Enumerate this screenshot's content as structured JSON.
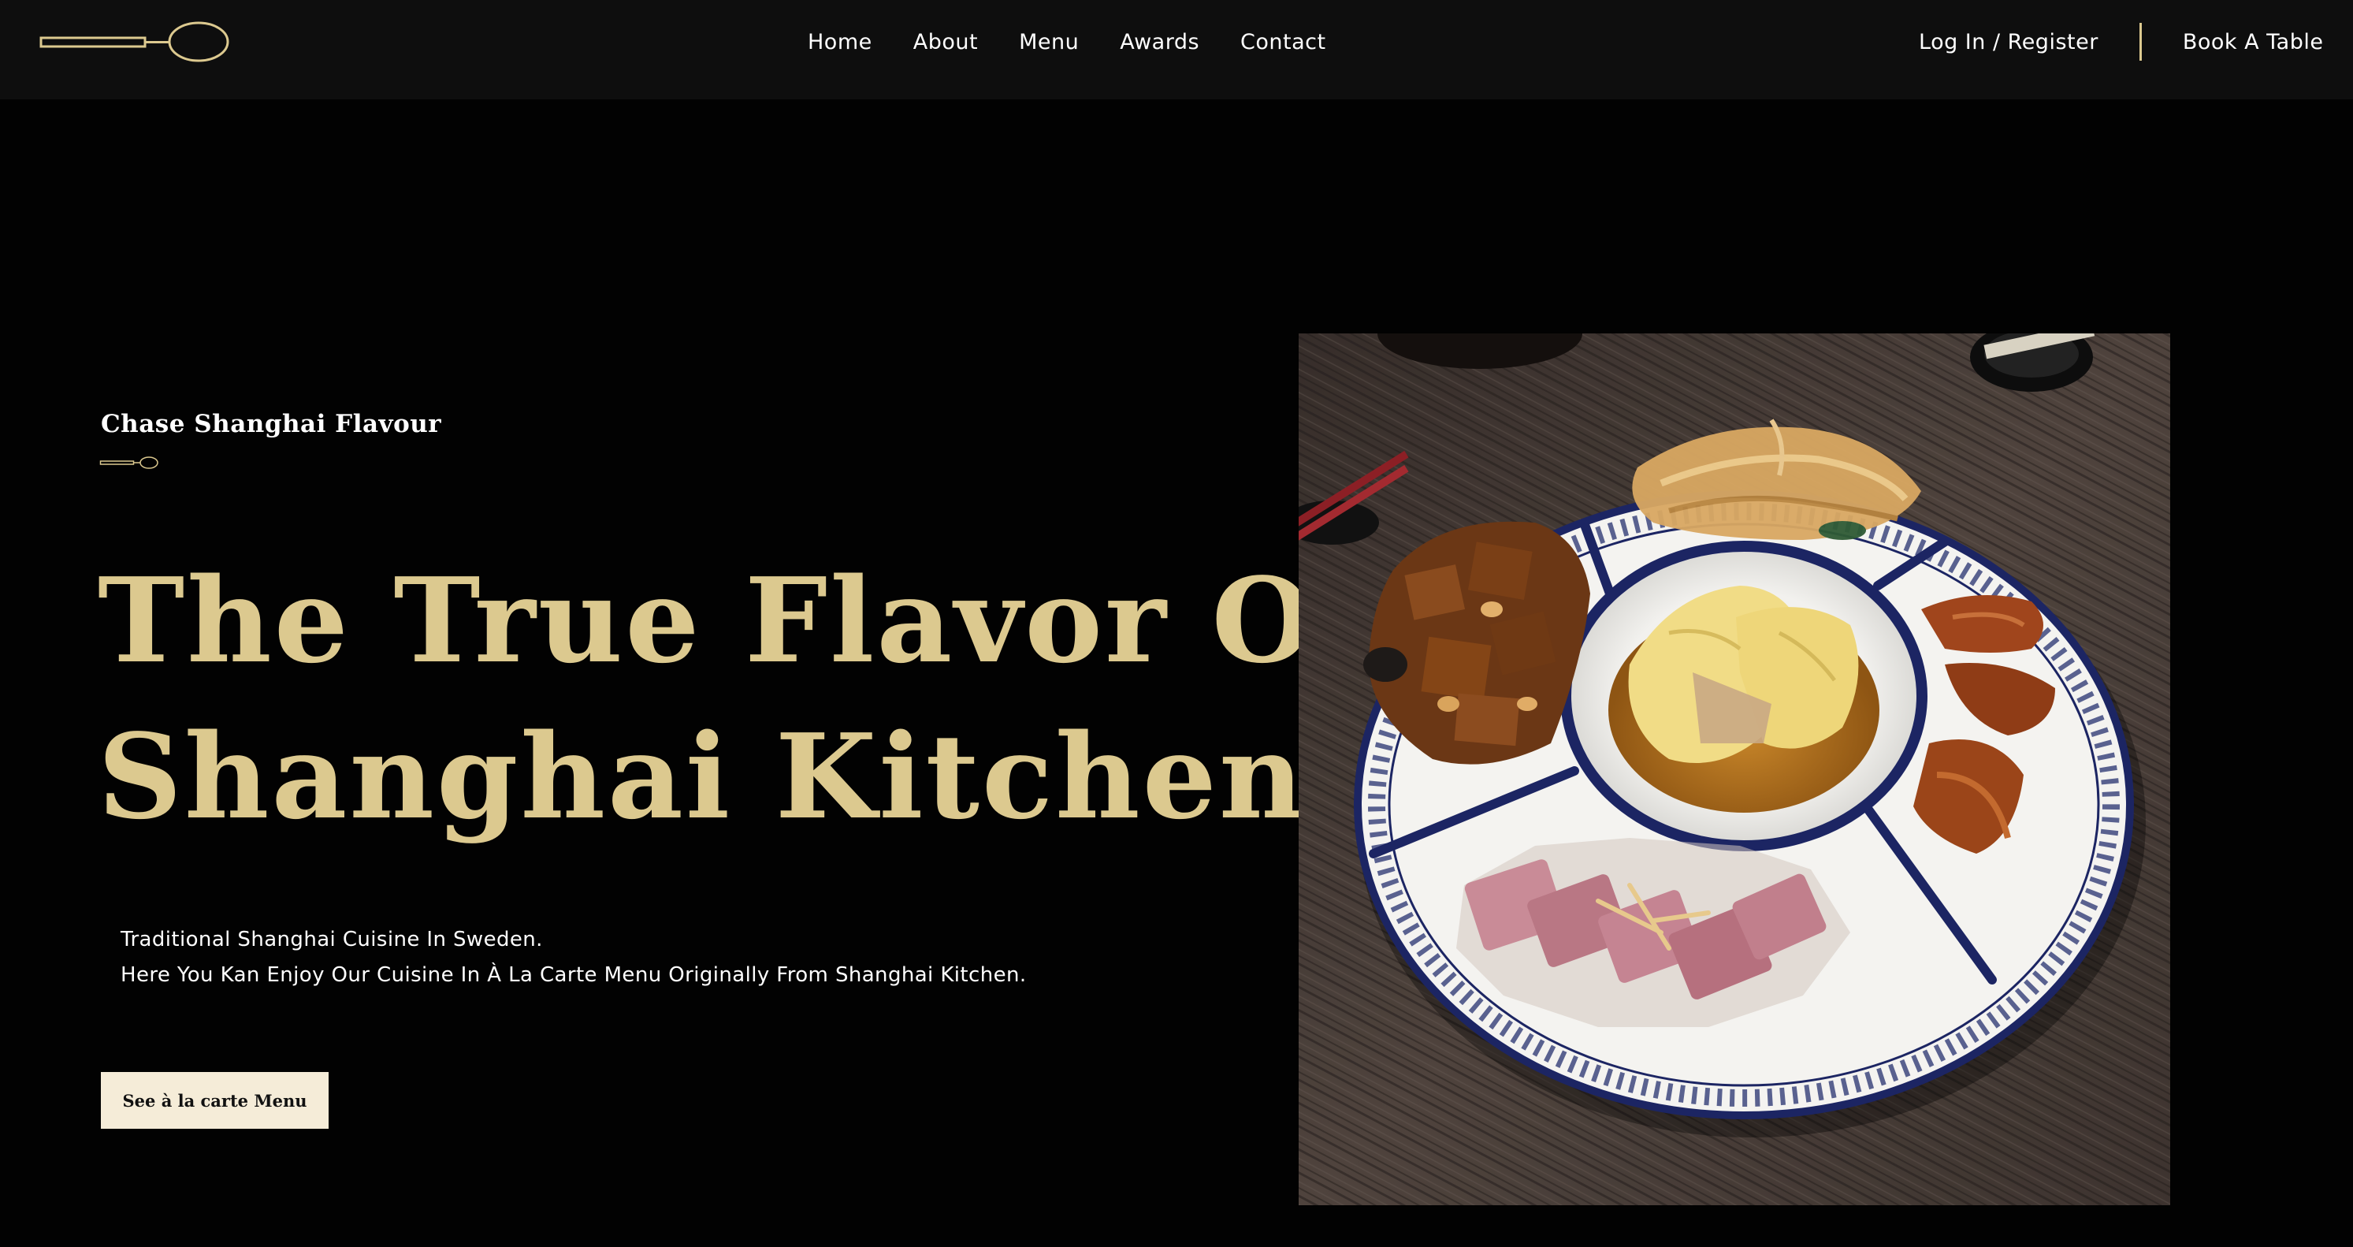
{
  "nav": {
    "links": [
      "Home",
      "About",
      "Menu",
      "Awards",
      "Contact"
    ],
    "login": "Log In / Register",
    "book": "Book A Table"
  },
  "hero": {
    "kicker": "Chase Shanghai Flavour",
    "title_line1": "The True Flavor Of",
    "title_line2": "Shanghai Kitchen",
    "desc_line1": "Traditional Shanghai Cuisine In Sweden.",
    "desc_line2": "Here You Kan Enjoy Our Cuisine In À La Carte Menu Originally From Shanghai Kitchen.",
    "cta": "See à la carte Menu"
  },
  "icons": {
    "logo": "spoon-logo-icon",
    "kicker": "spoon-icon"
  },
  "colors": {
    "accent": "#dcc98f",
    "background": "#020202",
    "header": "#0e0e0e",
    "button": "#f5ecd8"
  }
}
